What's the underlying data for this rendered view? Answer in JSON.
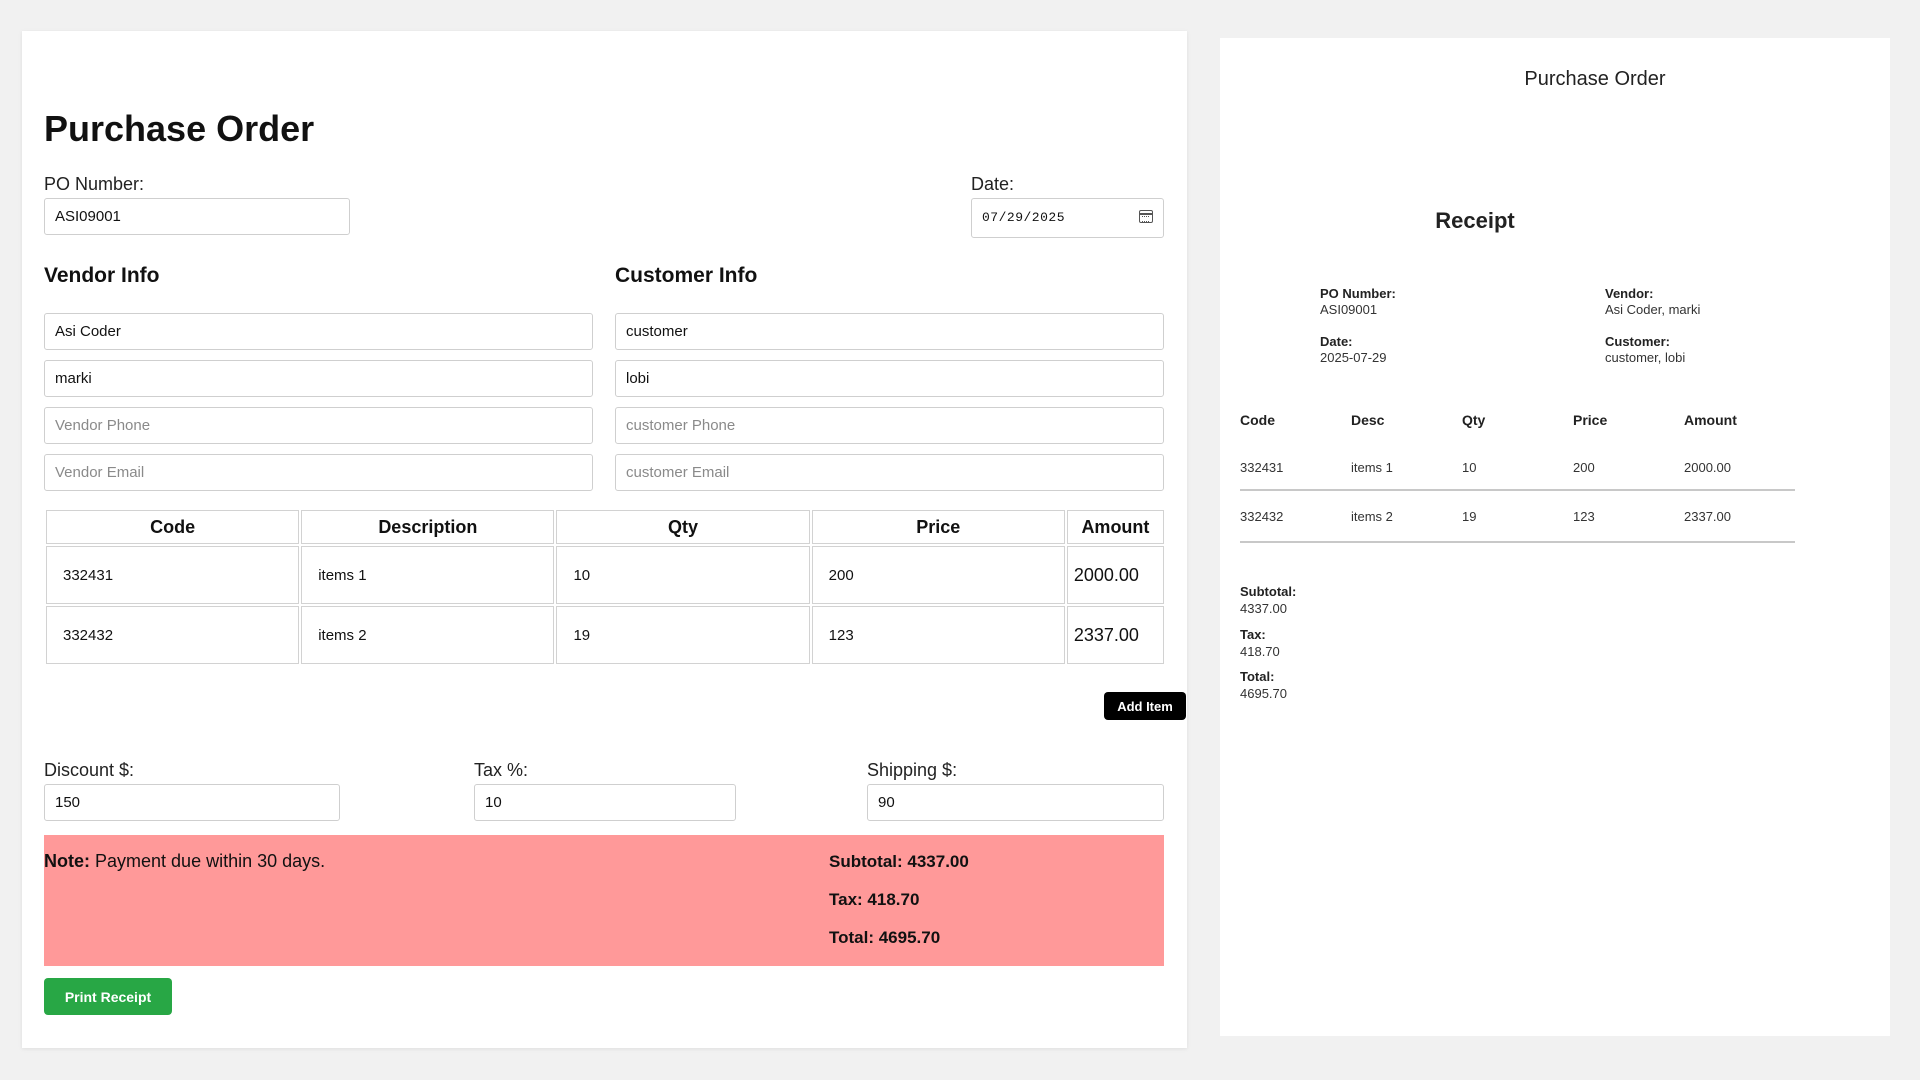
{
  "form": {
    "title": "Purchase Order",
    "po_label": "PO Number:",
    "po_value": "ASI09001",
    "date_label": "Date:",
    "date_value": "07/29/2025",
    "vendor_title": "Vendor Info",
    "customer_title": "Customer Info",
    "vendor": {
      "name": "Asi Coder",
      "contact": "marki",
      "phone_placeholder": "Vendor Phone",
      "email_placeholder": "Vendor Email"
    },
    "customer": {
      "name": "customer",
      "contact": "lobi",
      "phone_placeholder": "customer Phone",
      "email_placeholder": "customer Email"
    },
    "table": {
      "headers": [
        "Code",
        "Description",
        "Qty",
        "Price",
        "Amount"
      ],
      "rows": [
        {
          "code": "332431",
          "desc": "items 1",
          "qty": "10",
          "price": "200",
          "amount": "2000.00"
        },
        {
          "code": "332432",
          "desc": "items 2",
          "qty": "19",
          "price": "123",
          "amount": "2337.00"
        }
      ]
    },
    "add_item_label": "Add Item",
    "discount_label": "Discount $:",
    "discount_value": "150",
    "tax_label": "Tax %:",
    "tax_value": "10",
    "shipping_label": "Shipping $:",
    "shipping_value": "90",
    "note_label": "Note:",
    "note_text": "Payment due within 30 days.",
    "subtotal_line": "Subtotal: 4337.00",
    "tax_line": "Tax: 418.70",
    "total_line": "Total: 4695.70",
    "print_label": "Print Receipt",
    "colors": {
      "summary_bg": "#ff9999",
      "print_button": "#28a745",
      "add_button": "#000000"
    }
  },
  "receipt": {
    "doc_title": "Purchase Order",
    "title": "Receipt",
    "po_label": "PO Number:",
    "po_value": "ASI09001",
    "date_label": "Date:",
    "date_value": "2025-07-29",
    "vendor_label": "Vendor:",
    "vendor_value": "Asi Coder, marki",
    "customer_label": "Customer:",
    "customer_value": "customer, lobi",
    "headers": [
      "Code",
      "Desc",
      "Qty",
      "Price",
      "Amount"
    ],
    "rows": [
      {
        "code": "332431",
        "desc": "items 1",
        "qty": "10",
        "price": "200",
        "amount": "2000.00"
      },
      {
        "code": "332432",
        "desc": "items 2",
        "qty": "19",
        "price": "123",
        "amount": "2337.00"
      }
    ],
    "subtotal_label": "Subtotal:",
    "subtotal_value": "4337.00",
    "tax_label": "Tax:",
    "tax_value": "418.70",
    "total_label": "Total:",
    "total_value": "4695.70"
  }
}
